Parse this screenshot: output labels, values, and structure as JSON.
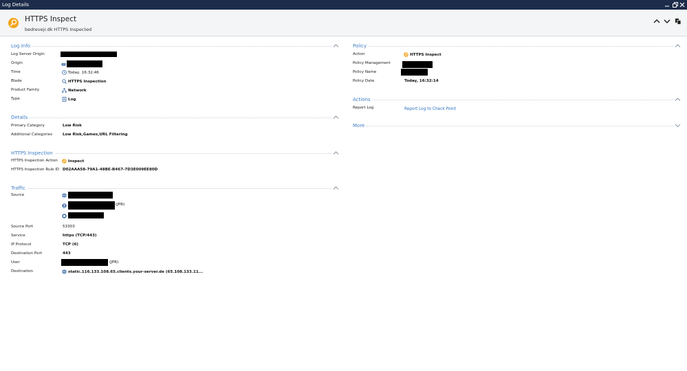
{
  "window": {
    "title": "Log Details"
  },
  "header": {
    "title": "HTTPS Inspect",
    "subtitle": "bedrevejr.dk HTTPS Inspected"
  },
  "colors": {
    "accent": "#3f7dc4",
    "titlebar": "#1c2c4a",
    "badge": "#f3a51c",
    "link": "#2e6fc2"
  },
  "log_info": {
    "title": "Log Info",
    "rows": [
      {
        "label": "Log Server Origin",
        "value": "",
        "redacted": true
      },
      {
        "label": "Origin",
        "value": "",
        "icon": "gateway-icon",
        "redacted": true
      },
      {
        "label": "Time",
        "value": "Today, 16:32:46",
        "icon": "clock-icon"
      },
      {
        "label": "Blade",
        "value": "HTTPS Inspection",
        "icon": "magnifier-icon"
      },
      {
        "label": "Product Family",
        "value": "Network",
        "icon": "network-icon"
      },
      {
        "label": "Type",
        "value": "Log",
        "icon": "log-icon"
      }
    ]
  },
  "details": {
    "title": "Details",
    "rows": [
      {
        "label": "Primary Category",
        "value": "Low Risk"
      },
      {
        "label": "Additional Categories",
        "value": "Low Risk,Games,URL Filtering"
      }
    ]
  },
  "https_inspection": {
    "title": "HTTPS Inspection",
    "rows": [
      {
        "label": "HTTPS Inspection Action",
        "value": "Inspect",
        "icon": "inspect-icon"
      },
      {
        "label": "HTTPS Inspection Rule ID",
        "value": "D02AAA58-79A1-48BE-B467-7D3E009EE80D"
      }
    ]
  },
  "traffic": {
    "title": "Traffic",
    "source_label": "Source",
    "source_user_suffix": "(JPR)",
    "rows": [
      {
        "label": "Source Port",
        "value": "53303"
      },
      {
        "label": "Service",
        "value": "https (TCP/443)"
      },
      {
        "label": "IP Protocol",
        "value": "TCP (6)"
      },
      {
        "label": "Destination Port",
        "value": "443"
      },
      {
        "label": "User",
        "value": "(JPR)",
        "redacted": true
      },
      {
        "label": "Destination",
        "value": "static.116.133.108.65.clients.your-server.de (65.108.133.11...",
        "icon": "globe-icon"
      }
    ]
  },
  "policy": {
    "title": "Policy",
    "rows": [
      {
        "label": "Action",
        "value": "HTTPS Inspect",
        "icon": "inspect-icon"
      },
      {
        "label": "Policy Management",
        "value": "",
        "redacted": true
      },
      {
        "label": "Policy Name",
        "value": "",
        "redacted": true
      },
      {
        "label": "Policy Date",
        "value": "Today, 16:32:14"
      }
    ]
  },
  "actions": {
    "title": "Actions",
    "report_label": "Report Log",
    "report_link": "Report Log to Check Point"
  },
  "more": {
    "title": "More"
  }
}
